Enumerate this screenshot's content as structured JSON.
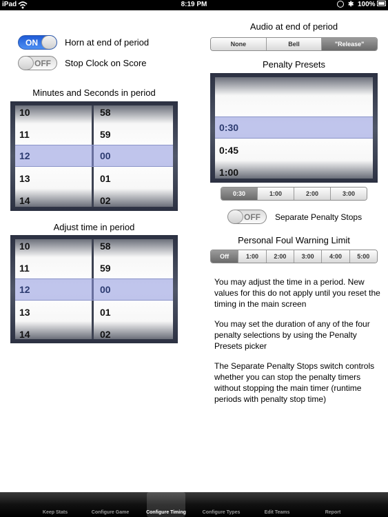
{
  "status_bar": {
    "device": "iPad",
    "time": "8:19 PM",
    "battery": "100%"
  },
  "left": {
    "horn_toggle": {
      "state": "ON",
      "label": "Horn at end of period"
    },
    "stop_clock_toggle": {
      "state": "OFF",
      "label": "Stop Clock on Score"
    },
    "minutes_seconds_title": "Minutes and Seconds in period",
    "minutes_seconds_picker": {
      "minutes": [
        "10",
        "11",
        "12",
        "13",
        "14"
      ],
      "seconds": [
        "58",
        "59",
        "00",
        "01",
        "02"
      ]
    },
    "adjust_time_title": "Adjust time in period",
    "adjust_time_picker": {
      "minutes": [
        "10",
        "11",
        "12",
        "13",
        "14"
      ],
      "seconds": [
        "58",
        "59",
        "00",
        "01",
        "02"
      ]
    }
  },
  "right": {
    "audio_title": "Audio at end of period",
    "audio_options": [
      "None",
      "Bell",
      "\"Release\""
    ],
    "audio_selected": "\"Release\"",
    "penalty_presets_title": "Penalty Presets",
    "penalty_picker": [
      "0:30",
      "0:45",
      "1:00"
    ],
    "penalty_segments": [
      "0:30",
      "1:00",
      "2:00",
      "3:00"
    ],
    "penalty_selected": "0:30",
    "separate_toggle": {
      "state": "OFF",
      "label": "Separate Penalty Stops"
    },
    "foul_title": "Personal Foul Warning Limit",
    "foul_segments": [
      "Off",
      "1:00",
      "2:00",
      "3:00",
      "4:00",
      "5:00"
    ],
    "foul_selected": "Off",
    "info": [
      "You may adjust the time in a period. New values for this do not apply until you reset the timing in the main screen",
      "You may set the duration of any of the four penalty selections by using the Penalty Presets picker",
      "The Separate Penalty Stops switch controls whether you can stop the penalty timers without stopping the main timer (runtime periods with penalty stop time)"
    ]
  },
  "tabs": [
    "Keep Stats",
    "Configure Game",
    "Configure Timing",
    "Configure Types",
    "Edit Teams",
    "Report"
  ],
  "selected_tab": "Configure Timing",
  "colors": {
    "toggle_on": "#2f6fe3",
    "selection_band": "#8c96dc",
    "tab_bar": "#111111"
  }
}
